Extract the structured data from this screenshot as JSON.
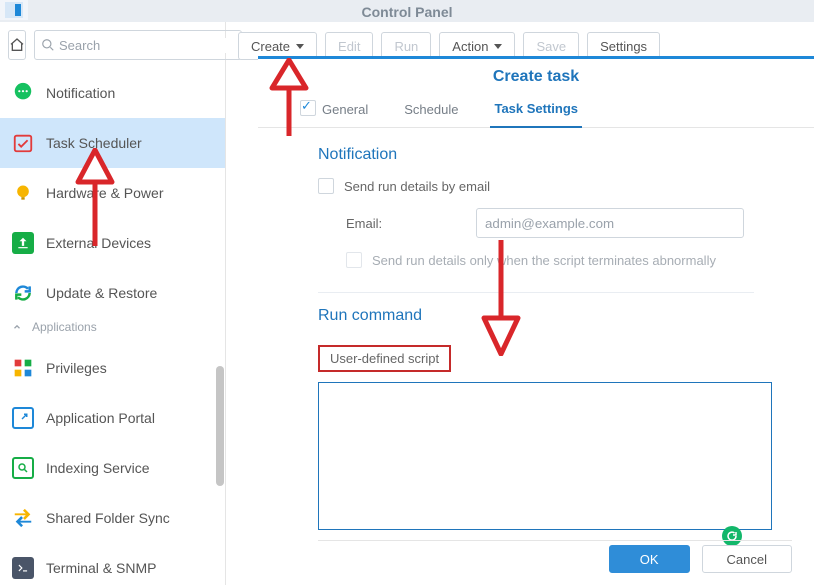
{
  "titlebar": {
    "title": "Control Panel"
  },
  "search": {
    "placeholder": "Search"
  },
  "sidebar": {
    "items": [
      {
        "label": "Notification"
      },
      {
        "label": "Task Scheduler"
      },
      {
        "label": "Hardware & Power"
      },
      {
        "label": "External Devices"
      },
      {
        "label": "Update & Restore"
      }
    ],
    "section": "Applications",
    "apps": [
      {
        "label": "Privileges"
      },
      {
        "label": "Application Portal"
      },
      {
        "label": "Indexing Service"
      },
      {
        "label": "Shared Folder Sync"
      },
      {
        "label": "Terminal & SNMP"
      }
    ]
  },
  "toolbar": {
    "create": "Create",
    "edit": "Edit",
    "run": "Run",
    "action": "Action",
    "save": "Save",
    "settings": "Settings"
  },
  "panel": {
    "title": "Create task",
    "tabs": {
      "general": "General",
      "schedule": "Schedule",
      "settings": "Task Settings"
    },
    "notification": {
      "heading": "Notification",
      "send_details": "Send run details by email",
      "email_label": "Email:",
      "email_placeholder": "admin@example.com",
      "abnormal": "Send run details only when the script terminates abnormally"
    },
    "run_command": {
      "heading": "Run command",
      "user_defined": "User-defined script",
      "script": ""
    },
    "footer": {
      "ok": "OK",
      "cancel": "Cancel"
    }
  }
}
